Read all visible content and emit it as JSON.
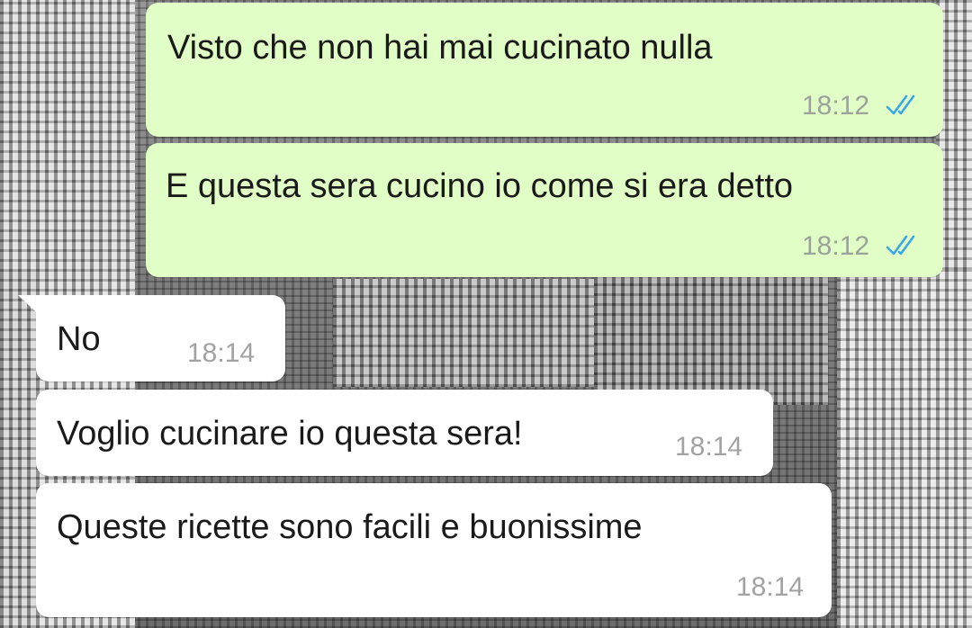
{
  "chat": {
    "messages": [
      {
        "direction": "outgoing",
        "text": "Visto che non hai mai cucinato nulla",
        "time": "18:12",
        "status": "read-double-check-icon"
      },
      {
        "direction": "outgoing",
        "text": "E questa sera cucino io come si era detto",
        "time": "18:12",
        "status": "read-double-check-icon"
      },
      {
        "direction": "incoming",
        "text": "No",
        "time": "18:14"
      },
      {
        "direction": "incoming",
        "text": "Voglio cucinare io questa sera!",
        "time": "18:14"
      },
      {
        "direction": "incoming",
        "text": "Queste ricette sono facili e buonissime",
        "time": "18:14"
      }
    ]
  },
  "colors": {
    "outgoing_bubble": "#e1fec6",
    "incoming_bubble": "#ffffff",
    "read_ticks": "#3aa7e8",
    "timestamp": "#9aa39a"
  }
}
